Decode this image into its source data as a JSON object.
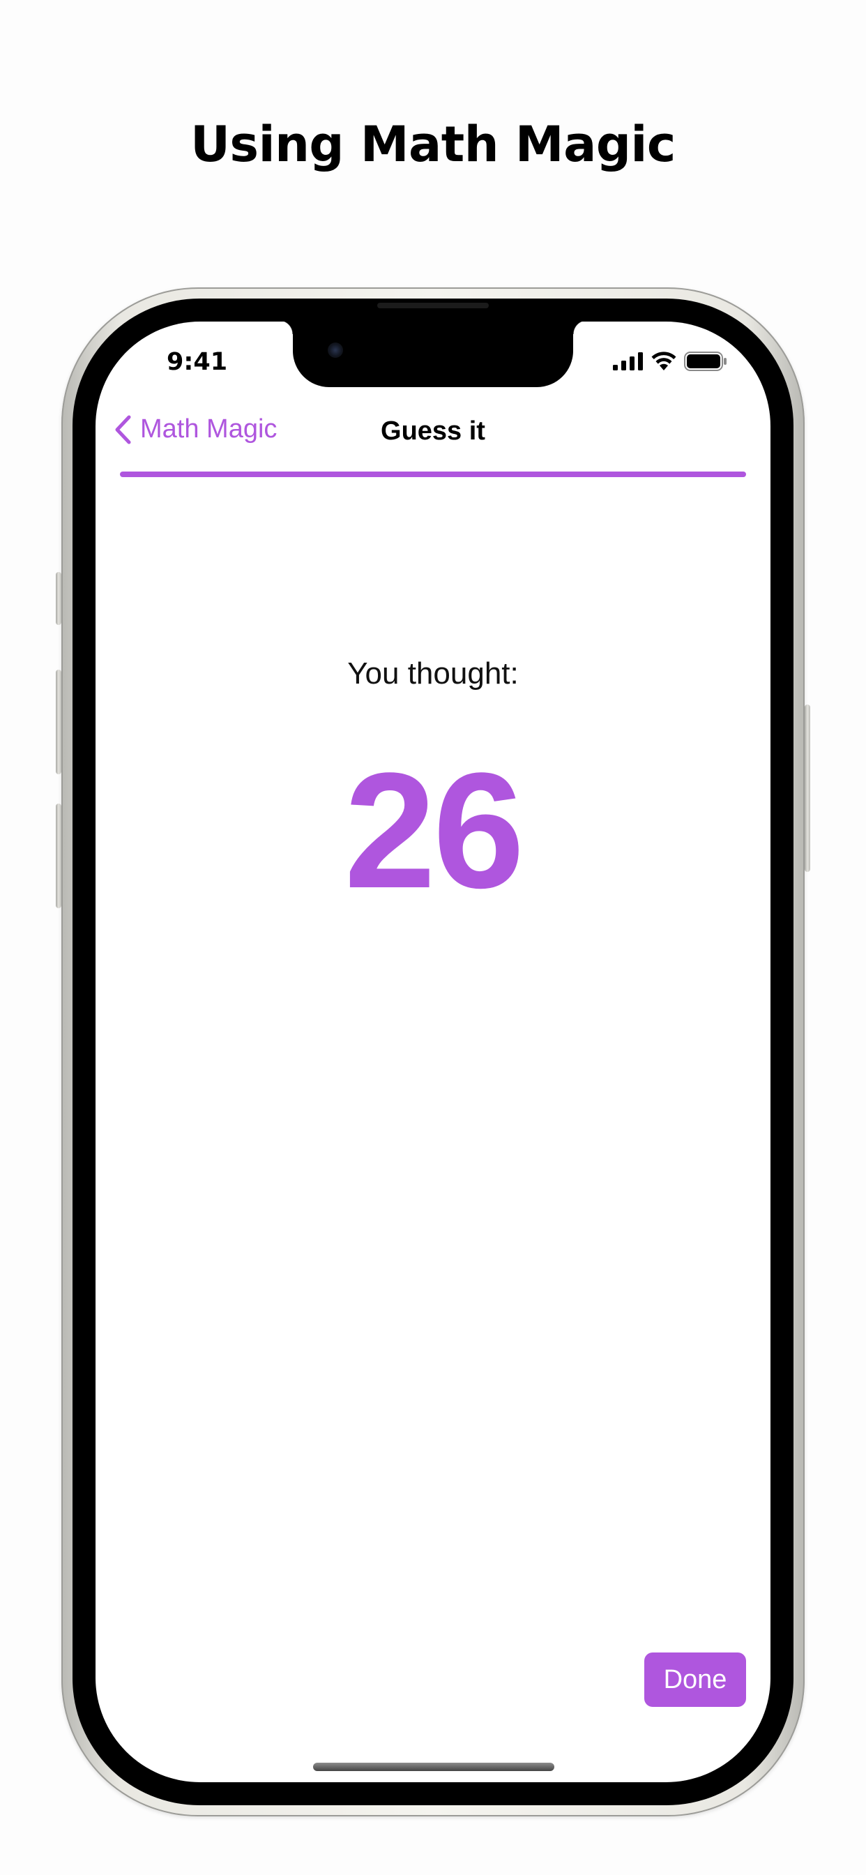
{
  "headline": "Using Math Magic",
  "status_bar": {
    "time": "9:41",
    "icons": [
      "cellular-signal-icon",
      "wifi-icon",
      "battery-icon"
    ]
  },
  "nav": {
    "back_label": "Math Magic",
    "title": "Guess it"
  },
  "content": {
    "prompt": "You thought:",
    "result": "26"
  },
  "actions": {
    "done_label": "Done"
  },
  "colors": {
    "accent": "#af56de",
    "text": "#000000",
    "background": "#ffffff"
  }
}
